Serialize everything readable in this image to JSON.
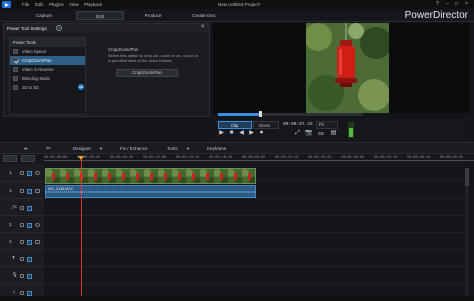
{
  "menubar": {
    "items": [
      "File",
      "Edit",
      "Plugins",
      "View",
      "Playback"
    ],
    "window_title": "New Untitled Project*",
    "controls": [
      "?",
      "−",
      "□",
      "×"
    ]
  },
  "modes": {
    "tabs": [
      "Capture",
      "Edit",
      "Produce",
      "Create Disc"
    ],
    "active": "Edit",
    "brand": "PowerDirector"
  },
  "power_tools": {
    "title": "Power Tool Settings",
    "help": "?",
    "close": "×",
    "list_header": "Power Tools",
    "items": [
      {
        "label": "Video Speed",
        "checked": false,
        "selected": false
      },
      {
        "label": "Crop/Zoom/Pan",
        "checked": true,
        "selected": true
      },
      {
        "label": "Video in Reverse",
        "checked": false,
        "selected": false
      },
      {
        "label": "Blending Mode",
        "checked": false,
        "selected": false
      },
      {
        "label": "2D to 3D",
        "checked": false,
        "selected": false
      }
    ],
    "badge_3d": "3D",
    "desc_title": "Crop/Zoom/Pan",
    "desc": "Select this option to crop out, zoom in on, or pan in a specified area of the video frames.",
    "crop_button": "Crop/Zoom/Pan"
  },
  "player": {
    "clip_label": "Clip",
    "movie_label": "Movie",
    "timecode": "00:00:07.26",
    "fit": "Fit",
    "progress": 0.29,
    "buttons": [
      "▶",
      "■",
      "◀",
      "▶",
      "⏺",
      "⤢",
      "📷",
      "3D",
      "▤"
    ]
  },
  "toolbar": {
    "split_icon": "split-icon",
    "designer": "Designer",
    "fix": "Fix / Enhance",
    "tools": "Tools",
    "keyframe": "Keyframe"
  },
  "ruler": {
    "ticks": [
      "00:00:00:00",
      "00:00:03:10",
      "00:00:06:20",
      "00:00:10:00",
      "00:00:13:10",
      "00:00:16:20",
      "00:00:20:00",
      "00:00:23:10",
      "00:00:26:20",
      "00:00:30:00",
      "00:00:33:10",
      "00:00:36:20",
      "00:00:40:00"
    ]
  },
  "tracks": [
    {
      "num": "1.",
      "type": "video"
    },
    {
      "num": "1.",
      "type": "audio"
    },
    {
      "num": "",
      "type": "fx"
    },
    {
      "num": "2.",
      "type": "video"
    },
    {
      "num": "2.",
      "type": "audio"
    },
    {
      "num": "T",
      "type": "title"
    },
    {
      "num": "",
      "type": "voice"
    },
    {
      "num": "",
      "type": "music"
    }
  ],
  "clips": {
    "video_title": "",
    "audio_title": "MVI_0138.MOV"
  },
  "colors": {
    "accent": "#3b8fe0",
    "playhead": "#e23a2a",
    "video_clip": "#3a5e2e",
    "audio_clip": "#2c5c86"
  }
}
